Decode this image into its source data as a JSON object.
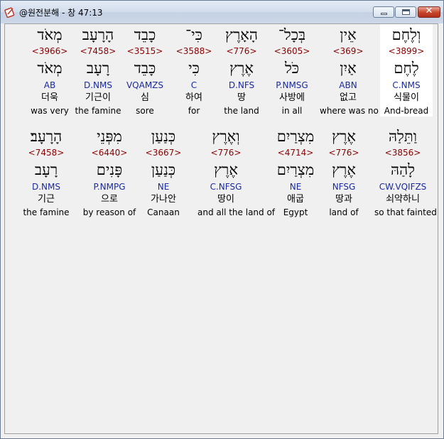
{
  "window": {
    "title": "@원전분해 - 창 47:13",
    "app_icon": "book-pen-icon",
    "controls": {
      "minimize": "minimize-icon",
      "maximize": "maximize-icon",
      "close_label": "✕"
    }
  },
  "rows": [
    {
      "words": [
        {
          "hebrew": "מְאֹד",
          "strong": "<3966>",
          "lemma": "מְאֹד",
          "morph": "AB",
          "korean": "더욱",
          "english": "was very",
          "highlighted": false
        },
        {
          "hebrew": "הָרָעָב",
          "strong": "<7458>",
          "lemma": "רָעָב",
          "morph": "D.NMS",
          "korean": "기근이",
          "english": "the famine",
          "highlighted": false
        },
        {
          "hebrew": "כָבֵד",
          "strong": "<3515>",
          "lemma": "כָּבֵד",
          "morph": "VQAMZS",
          "korean": "심",
          "english": "sore",
          "highlighted": false
        },
        {
          "hebrew": "כִּי־",
          "strong": "<3588>",
          "lemma": "כִּי",
          "morph": "C",
          "korean": "하여",
          "english": "for",
          "highlighted": false
        },
        {
          "hebrew": "הָאָרֶץ",
          "strong": "<776>",
          "lemma": "אֶרֶץ",
          "morph": "D.NFS",
          "korean": "땅",
          "english": "the land",
          "highlighted": false
        },
        {
          "hebrew": "בְּכָל־",
          "strong": "<3605>",
          "lemma": "כֹּל",
          "morph": "P.NMSG",
          "korean": "사방에",
          "english": "in all",
          "highlighted": false
        },
        {
          "hebrew": "אֵין",
          "strong": "<369>",
          "lemma": "אַיִן",
          "morph": "ABN",
          "korean": "없고",
          "english": "where was no",
          "highlighted": false
        },
        {
          "hebrew": "וְלֶחֶם",
          "strong": "<3899>",
          "lemma": "לֶחֶם",
          "morph": "C.NMS",
          "korean": "식물이",
          "english": "And-bread",
          "highlighted": true
        }
      ]
    },
    {
      "words": [
        {
          "hebrew": "הָרָעָב׃",
          "strong": "<7458>",
          "lemma": "רָעָב",
          "morph": "D.NMS",
          "korean": "기근",
          "english": "the famine",
          "highlighted": false
        },
        {
          "hebrew": "מִפְּנֵי",
          "strong": "<6440>",
          "lemma": "פָּנִים",
          "morph": "P.NMPG",
          "korean": "으로",
          "english": "by reason of",
          "highlighted": false
        },
        {
          "hebrew": "כְּנַעַן",
          "strong": "<3667>",
          "lemma": "כְּנַעַן",
          "morph": "NE",
          "korean": "가나안",
          "english": "Canaan",
          "highlighted": false
        },
        {
          "hebrew": "וְאֶרֶץ",
          "strong": "<776>",
          "lemma": "אֶרֶץ",
          "morph": "C.NFSG",
          "korean": "땅이",
          "english": "and all the land of",
          "highlighted": false
        },
        {
          "hebrew": "מִצְרַיִם",
          "strong": "<4714>",
          "lemma": "מִצְרַיִם",
          "morph": "NE",
          "korean": "애굽",
          "english": "Egypt",
          "highlighted": false
        },
        {
          "hebrew": "אֶרֶץ",
          "strong": "<776>",
          "lemma": "אֶרֶץ",
          "morph": "NFSG",
          "korean": "땅과",
          "english": "land of",
          "highlighted": false
        },
        {
          "hebrew": "וַתֵּלַהּ",
          "strong": "<3856>",
          "lemma": "לָהַהּ",
          "morph": "CW.VQIFZS",
          "korean": "쇠약하니",
          "english": "so that fainted",
          "highlighted": false
        }
      ]
    }
  ],
  "colors": {
    "strong": "#8b0000",
    "morph": "#1a2aa0",
    "highlight_bg": "#ffffff",
    "window_bg": "#f0f0f0"
  }
}
